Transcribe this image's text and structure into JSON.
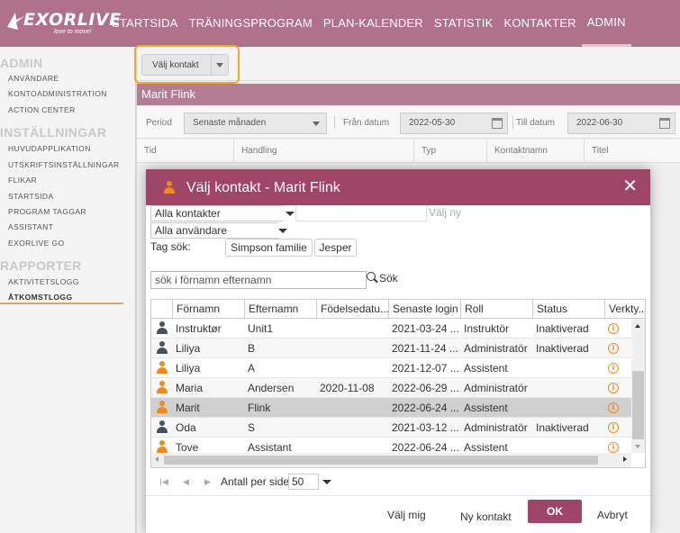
{
  "brand": {
    "name": "EXORLIVE",
    "tagline": "love to move!"
  },
  "nav": {
    "items": [
      "STARTSIDA",
      "TRÄNINGSPROGRAM",
      "PLAN-KALENDER",
      "STATISTIK",
      "KONTAKTER",
      "ADMIN"
    ],
    "active": "ADMIN"
  },
  "sidebar": {
    "sections": [
      {
        "title": "ADMIN",
        "items": [
          "ANVÄNDARE",
          "KONTOADMINISTRATION",
          "ACTION CENTER"
        ]
      },
      {
        "title": "INSTÄLLNINGAR",
        "items": [
          "HUVUDAPPLIKATION",
          "UTSKRIFTSINSTÄLLNINGAR",
          "FLIKAR",
          "STARTSIDA",
          "PROGRAM TAGGAR",
          "ASSISTANT",
          "EXORLIVE GO"
        ]
      },
      {
        "title": "RAPPORTER",
        "items": [
          "AKTIVITETSLOGG",
          "ÅTKOMSTLOGG"
        ]
      }
    ],
    "active_item": "ÅTKOMSTLOGG"
  },
  "toolbar": {
    "select_contact_label": "Välj kontakt"
  },
  "report": {
    "title": "Marit Flink",
    "period_label": "Period",
    "period_value": "Senaste månaden",
    "from_label": "Från datum",
    "from_value": "2022-05-30",
    "to_label": "Till datum",
    "to_value": "2022-06-30",
    "columns": [
      "Tid",
      "Handling",
      "Typ",
      "Kontaktnamn",
      "Titel"
    ]
  },
  "modal": {
    "title": "Välj kontakt - Marit Flink",
    "contacts_filter": "Alla kontakter",
    "new_label": "Välj ny",
    "users_filter": "Alla användare",
    "tag_label": "Tag sök:",
    "tags": [
      "Simpson familie",
      "Jesper"
    ],
    "search_placeholder": "sök i förnamn efternamn",
    "search_label": "Sök",
    "columns": [
      "Förnamn",
      "Efternamn",
      "Födelsedatu...",
      "Senaste login",
      "Roll",
      "Status",
      "Verkty..."
    ],
    "rows": [
      {
        "first": "Instruktør",
        "last": "Unit1",
        "birth": "",
        "login": "2021-03-24 ...",
        "role": "Instruktör",
        "status": "Inaktiverad",
        "icon": "person-gray"
      },
      {
        "first": "Liliya",
        "last": "B",
        "birth": "",
        "login": "2021-11-24 ...",
        "role": "Administratör",
        "status": "Inaktiverad",
        "icon": "person-gray"
      },
      {
        "first": "Liliya",
        "last": "A",
        "birth": "",
        "login": "2021-12-07 ...",
        "role": "Assistent",
        "status": "",
        "icon": "person-orange"
      },
      {
        "first": "Maria",
        "last": "Andersen",
        "birth": "2020-11-08",
        "login": "2022-06-29 ...",
        "role": "Administratör",
        "status": "",
        "icon": "person-orange"
      },
      {
        "first": "Marit",
        "last": "Flink",
        "birth": "",
        "login": "2022-06-24 ...",
        "role": "Assistent",
        "status": "",
        "icon": "person-orange",
        "selected": true
      },
      {
        "first": "Oda",
        "last": "S",
        "birth": "",
        "login": "2021-03-12 ...",
        "role": "Administratör",
        "status": "Inaktiverad",
        "icon": "person-gray"
      },
      {
        "first": "Tove",
        "last": "Assistant",
        "birth": "",
        "login": "2022-06-24 ...",
        "role": "Assistent",
        "status": "",
        "icon": "person-orange"
      }
    ],
    "per_page_label": "Antall per side",
    "per_page_value": "50",
    "footer": {
      "choose_me": "Välj mig",
      "new_contact": "Ny kontakt",
      "ok": "OK",
      "cancel": "Avbryt"
    }
  },
  "colors": {
    "accent": "#9f4568",
    "nav_bg": "#b0728a",
    "highlight": "#f0a830",
    "icon_orange": "#f08a1c",
    "icon_gray": "#4a5060"
  }
}
